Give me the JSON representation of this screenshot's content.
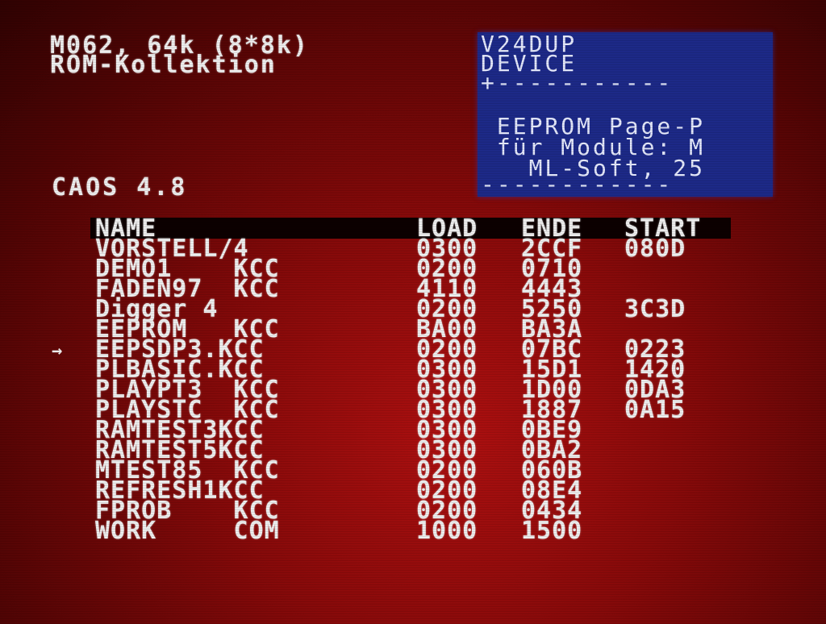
{
  "header": {
    "line1": "M062, 64k (8*8k)",
    "line2": "ROM-Kollektion"
  },
  "os_version": "CAOS 4.8",
  "info_box": {
    "line1": "V24DUP",
    "line2": "DEVICE",
    "separator": "+-----------",
    "line3": " EEPROM Page-P",
    "line4": " für Module: M",
    "line5": "   ML-Soft, 25",
    "separator2": "------------"
  },
  "table": {
    "columns": {
      "name": "NAME",
      "load": "LOAD",
      "ende": "ENDE",
      "start": "START"
    },
    "selected_marker": "→",
    "rows": [
      {
        "name": "VORSTELL/4",
        "load": "0300",
        "ende": "2CCF",
        "start": "080D"
      },
      {
        "name": "DEMO1    KCC",
        "load": "0200",
        "ende": "0710",
        "start": ""
      },
      {
        "name": "FADEN97  KCC",
        "load": "4110",
        "ende": "4443",
        "start": ""
      },
      {
        "name": "Digger 4",
        "load": "0200",
        "ende": "5250",
        "start": "3C3D"
      },
      {
        "name": "EEPROM   KCC",
        "load": "BA00",
        "ende": "BA3A",
        "start": ""
      },
      {
        "name": "EEPSDP3.KCC",
        "load": "0200",
        "ende": "07BC",
        "start": "0223"
      },
      {
        "name": "PLBASIC.KCC",
        "load": "0300",
        "ende": "15D1",
        "start": "1420"
      },
      {
        "name": "PLAYPT3  KCC",
        "load": "0300",
        "ende": "1D00",
        "start": "0DA3"
      },
      {
        "name": "PLAYSTC  KCC",
        "load": "0300",
        "ende": "1887",
        "start": "0A15"
      },
      {
        "name": "RAMTEST3KCC",
        "load": "0300",
        "ende": "0BE9",
        "start": ""
      },
      {
        "name": "RAMTEST5KCC",
        "load": "0300",
        "ende": "0BA2",
        "start": ""
      },
      {
        "name": "MTEST85  KCC",
        "load": "0200",
        "ende": "060B",
        "start": ""
      },
      {
        "name": "REFRESH1KCC",
        "load": "0200",
        "ende": "08E4",
        "start": ""
      },
      {
        "name": "FPROB    KCC",
        "load": "0200",
        "ende": "0434",
        "start": ""
      },
      {
        "name": "WORK     COM",
        "load": "1000",
        "ende": "1500",
        "start": ""
      }
    ]
  },
  "colors": {
    "background": "#9a0c0c",
    "info_box": "#1d2a8a",
    "text": "#f2f2f2",
    "header_bar": "#0c0000"
  }
}
